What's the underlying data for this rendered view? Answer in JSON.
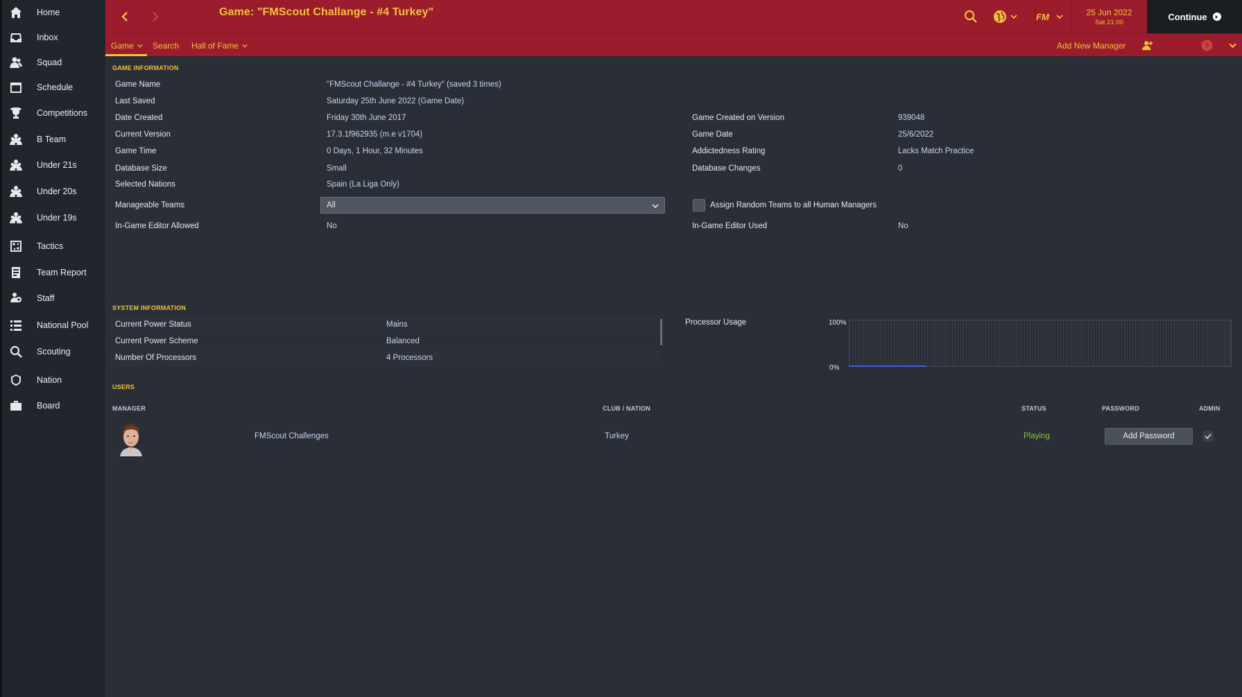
{
  "app": {
    "title": "Game: \"FMScout Challange - #4 Turkey\"",
    "date_main": "25 Jun 2022",
    "date_sub": "Sat 21:00",
    "continue_label": "Continue"
  },
  "colors": {
    "header_bg": "#9b1c2c",
    "accent_yellow": "#f2c23a",
    "sidebar_bg": "#21252c",
    "content_bg": "#2a2e36",
    "value_text": "#c6d6f0",
    "status_green": "#8cc63f",
    "graph_line": "#3d5be0"
  },
  "sidebar": {
    "items": [
      {
        "label": "Home",
        "icon": "home-icon"
      },
      {
        "label": "Inbox",
        "icon": "inbox-icon"
      },
      {
        "label": "Squad",
        "icon": "squad-icon"
      },
      {
        "label": "Schedule",
        "icon": "calendar-icon"
      },
      {
        "label": "Competitions",
        "icon": "trophy-icon"
      },
      {
        "label": "B Team",
        "icon": "team-icon"
      },
      {
        "label": "Under 21s",
        "icon": "team-icon"
      },
      {
        "label": "Under 20s",
        "icon": "team-icon"
      },
      {
        "label": "Under 19s",
        "icon": "team-icon"
      },
      {
        "label": "Tactics",
        "icon": "tactics-icon"
      },
      {
        "label": "Team Report",
        "icon": "report-icon"
      },
      {
        "label": "Staff",
        "icon": "staff-icon"
      },
      {
        "label": "National Pool",
        "icon": "list-icon"
      },
      {
        "label": "Scouting",
        "icon": "search-icon"
      },
      {
        "label": "Nation",
        "icon": "shield-icon"
      },
      {
        "label": "Board",
        "icon": "briefcase-icon"
      }
    ]
  },
  "subnav": {
    "game": "Game",
    "search": "Search",
    "hall_of_fame": "Hall of Fame",
    "add_new_manager": "Add New Manager"
  },
  "game_info": {
    "section_title": "GAME INFORMATION",
    "left": [
      {
        "label": "Game Name",
        "value": "\"FMScout Challange - #4 Turkey\" (saved 3 times)"
      },
      {
        "label": "Last Saved",
        "value": "Saturday 25th June 2022 (Game Date)"
      },
      {
        "label": "Date Created",
        "value": "Friday 30th June 2017"
      },
      {
        "label": "Current Version",
        "value": "17.3.1f962935 (m.e v1704)"
      },
      {
        "label": "Game Time",
        "value": "0 Days, 1 Hour, 32 Minutes"
      },
      {
        "label": "Database Size",
        "value": "Small"
      },
      {
        "label": "Selected Nations",
        "value": "Spain (La Liga Only)"
      }
    ],
    "right": [
      {
        "label": "Game Created on Version",
        "value": "939048"
      },
      {
        "label": "Game Date",
        "value": "25/6/2022"
      },
      {
        "label": "Addictedness Rating",
        "value": "Lacks Match Practice"
      },
      {
        "label": "Database Changes",
        "value": "0"
      }
    ],
    "manageable_teams_label": "Manageable Teams",
    "manageable_teams_value": "All",
    "assign_random_label": "Assign Random Teams to all Human Managers",
    "editor_allowed_label": "In-Game Editor Allowed",
    "editor_allowed_value": "No",
    "editor_used_label": "In-Game Editor Used",
    "editor_used_value": "No"
  },
  "system_info": {
    "section_title": "SYSTEM INFORMATION",
    "rows": [
      {
        "label": "Current Power Status",
        "value": "Mains"
      },
      {
        "label": "Current Power Scheme",
        "value": "Balanced"
      },
      {
        "label": "Number Of Processors",
        "value": "4 Processors"
      }
    ],
    "processor_usage_label": "Processor Usage",
    "axis_max": "100%",
    "axis_min": "0%"
  },
  "users": {
    "section_title": "USERS",
    "columns": {
      "manager": "MANAGER",
      "club_nation": "CLUB / NATION",
      "status": "STATUS",
      "password": "PASSWORD",
      "admin": "ADMIN"
    },
    "rows": [
      {
        "manager": "FMScout Challenges",
        "club": "Turkey",
        "status": "Playing",
        "password_button": "Add Password",
        "admin": true
      }
    ]
  }
}
